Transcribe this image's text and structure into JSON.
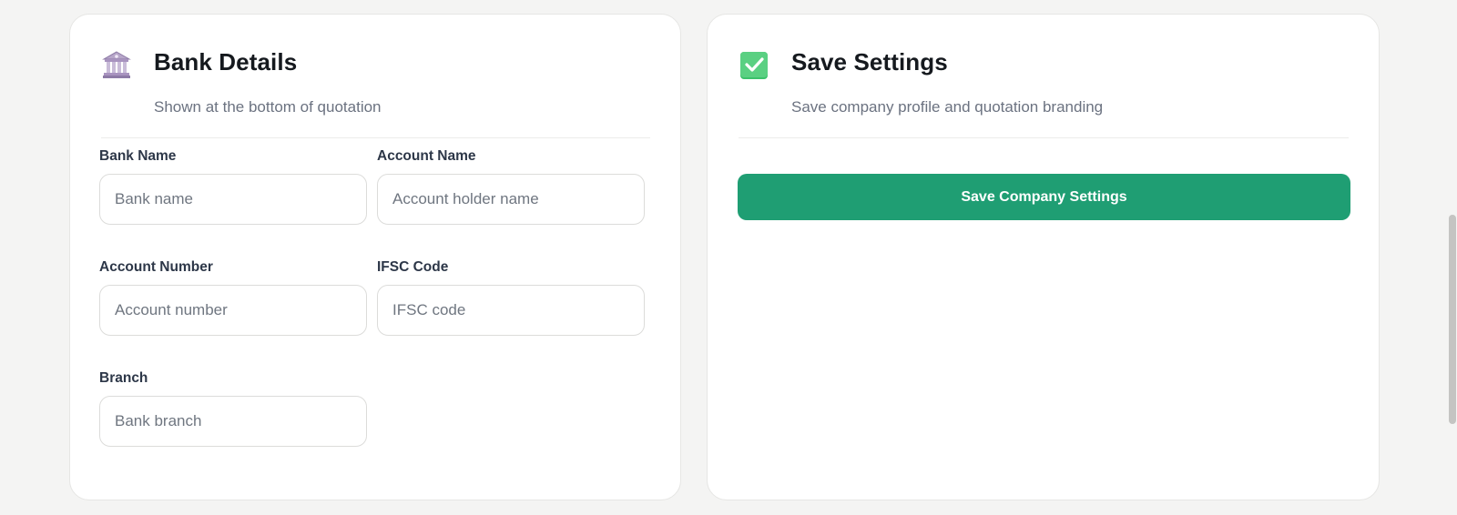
{
  "bank_details": {
    "icon": "bank-icon",
    "title": "Bank Details",
    "subtitle": "Shown at the bottom of quotation",
    "fields": {
      "bank_name": {
        "label": "Bank Name",
        "placeholder": "Bank name",
        "value": ""
      },
      "account_name": {
        "label": "Account Name",
        "placeholder": "Account holder name",
        "value": ""
      },
      "account_number": {
        "label": "Account Number",
        "placeholder": "Account number",
        "value": ""
      },
      "ifsc_code": {
        "label": "IFSC Code",
        "placeholder": "IFSC code",
        "value": ""
      },
      "branch": {
        "label": "Branch",
        "placeholder": "Bank branch",
        "value": ""
      }
    }
  },
  "save_settings": {
    "icon": "check-box-icon",
    "title": "Save Settings",
    "subtitle": "Save company profile and quotation branding",
    "button_label": "Save Company Settings"
  },
  "colors": {
    "accent": "#1f9e73",
    "check_icon": "#3cc26b",
    "background": "#f4f4f3",
    "card": "#ffffff"
  }
}
